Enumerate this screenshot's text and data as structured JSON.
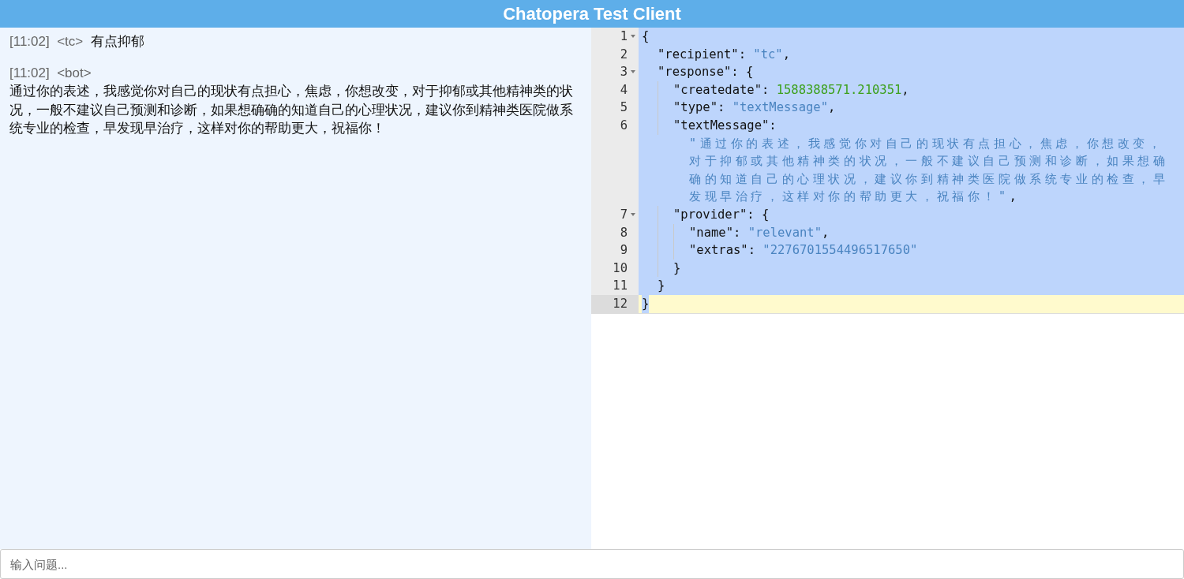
{
  "header": {
    "title": "Chatopera Test Client"
  },
  "chat": {
    "messages": [
      {
        "kind": "inline",
        "time": "[11:02]",
        "sender": "<tc>",
        "text": "有点抑郁"
      },
      {
        "kind": "block",
        "time": "[11:02]",
        "sender": "<bot>",
        "text": "通过你的表述，我感觉你对自己的现状有点担心，焦虑，你想改变，对于抑郁或其他精神类的状况，一般不建议自己预测和诊断，如果想确确的知道自己的心理状况，建议你到精神类医院做系统专业的检查，早发现早治疗，这样对你的帮助更大，祝福你！"
      }
    ]
  },
  "editor": {
    "lines": [
      {
        "number": "1",
        "foldable": true,
        "selected": true,
        "current": false,
        "tokens": [
          {
            "kind": "punct",
            "text": "{"
          }
        ]
      },
      {
        "number": "2",
        "foldable": false,
        "selected": true,
        "current": false,
        "tokens": [
          {
            "kind": "key",
            "text": "\"recipient\""
          },
          {
            "kind": "punct",
            "text": ": "
          },
          {
            "kind": "string",
            "text": "\"tc\""
          },
          {
            "kind": "punct",
            "text": ","
          }
        ]
      },
      {
        "number": "3",
        "foldable": true,
        "selected": true,
        "current": false,
        "tokens": [
          {
            "kind": "key",
            "text": "\"response\""
          },
          {
            "kind": "punct",
            "text": ": {"
          }
        ]
      },
      {
        "number": "4",
        "foldable": false,
        "selected": true,
        "current": false,
        "tokens": [
          {
            "kind": "key",
            "text": "\"createdate\""
          },
          {
            "kind": "punct",
            "text": ": "
          },
          {
            "kind": "number",
            "text": "1588388571.210351"
          },
          {
            "kind": "punct",
            "text": ","
          }
        ]
      },
      {
        "number": "5",
        "foldable": false,
        "selected": true,
        "current": false,
        "tokens": [
          {
            "kind": "key",
            "text": "\"type\""
          },
          {
            "kind": "punct",
            "text": ": "
          },
          {
            "kind": "string",
            "text": "\"textMessage\""
          },
          {
            "kind": "punct",
            "text": ","
          }
        ]
      },
      {
        "number": "6",
        "foldable": false,
        "selected": true,
        "current": false,
        "tokens": [
          {
            "kind": "key",
            "text": "\"textMessage\""
          },
          {
            "kind": "punct",
            "text": ":"
          }
        ],
        "wrapped": [
          {
            "kind": "string",
            "text": "\"通过你的表述，我感觉你对自己的现状有点担心，焦虑，你想改变，对于抑郁或其他精神类的状况，一般不建议自己预测和诊断，如果想确确的知道自己的心理状况，建议你到精神类医院做系统专业的检查，早发现早治疗，这样对你的帮助更大，祝福你！\""
          },
          {
            "kind": "punct",
            "text": ","
          }
        ]
      },
      {
        "number": "7",
        "foldable": true,
        "selected": true,
        "current": false,
        "tokens": [
          {
            "kind": "key",
            "text": "\"provider\""
          },
          {
            "kind": "punct",
            "text": ": {"
          }
        ]
      },
      {
        "number": "8",
        "foldable": false,
        "selected": true,
        "current": false,
        "tokens": [
          {
            "kind": "key",
            "text": "\"name\""
          },
          {
            "kind": "punct",
            "text": ": "
          },
          {
            "kind": "string",
            "text": "\"relevant\""
          },
          {
            "kind": "punct",
            "text": ","
          }
        ]
      },
      {
        "number": "9",
        "foldable": false,
        "selected": true,
        "current": false,
        "tokens": [
          {
            "kind": "key",
            "text": "\"extras\""
          },
          {
            "kind": "punct",
            "text": ": "
          },
          {
            "kind": "string",
            "text": "\"2276701554496517650\""
          }
        ]
      },
      {
        "number": "10",
        "foldable": false,
        "selected": true,
        "current": false,
        "tokens": [
          {
            "kind": "punct",
            "text": "}"
          }
        ]
      },
      {
        "number": "11",
        "foldable": false,
        "selected": true,
        "current": false,
        "tokens": [
          {
            "kind": "punct",
            "text": "}"
          }
        ]
      },
      {
        "number": "12",
        "foldable": false,
        "selected": true,
        "current": true,
        "tokens": [
          {
            "kind": "punct",
            "text": "}"
          }
        ]
      }
    ]
  },
  "input": {
    "placeholder": "输入问题..."
  }
}
